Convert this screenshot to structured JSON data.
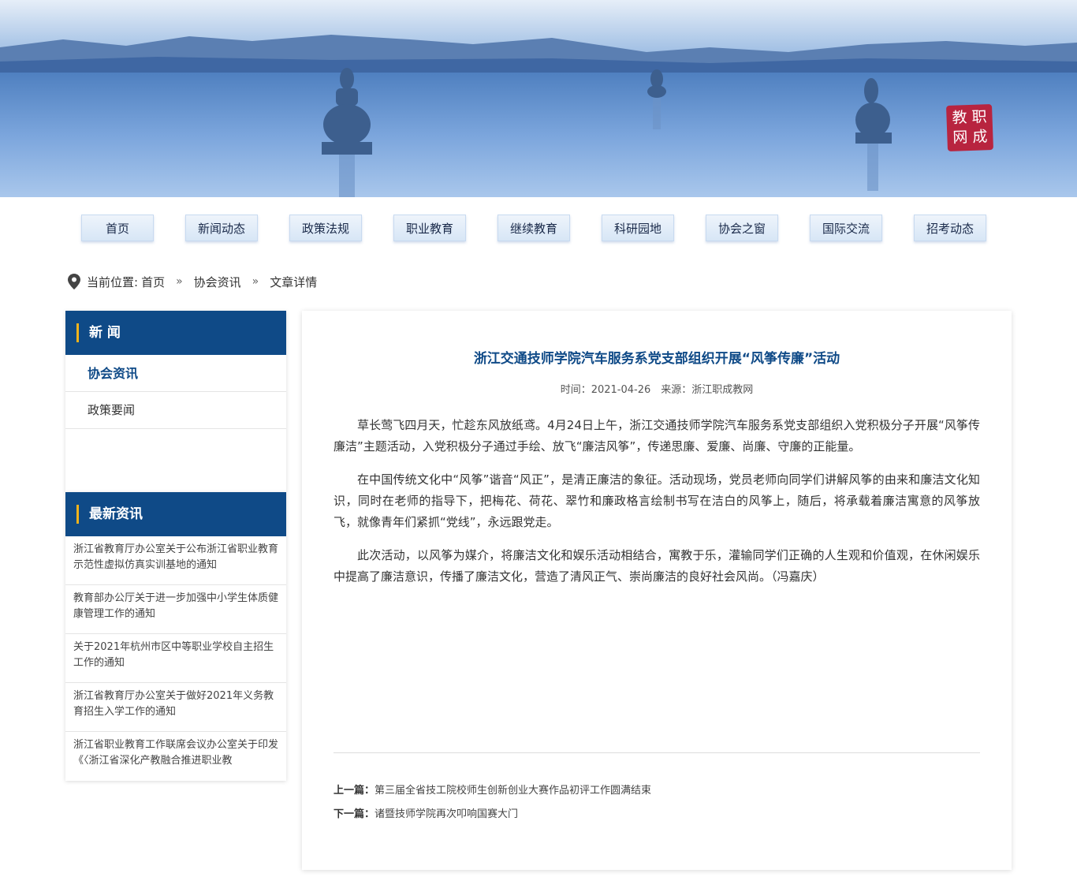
{
  "banner": {
    "seal_chars": [
      "教",
      "职",
      "网",
      "成"
    ]
  },
  "nav": {
    "items": [
      "首页",
      "新闻动态",
      "政策法规",
      "职业教育",
      "继续教育",
      "科研园地",
      "协会之窗",
      "国际交流",
      "招考动态"
    ]
  },
  "breadcrumb": {
    "prefix": "当前位置:",
    "home": "首页",
    "sep": "»",
    "section": "协会资讯",
    "current": "文章详情"
  },
  "sidebar": {
    "news_title": "新 闻",
    "news_items": [
      "协会资讯",
      "政策要闻"
    ],
    "latest_title": "最新资讯",
    "latest_items": [
      "浙江省教育厅办公室关于公布浙江省职业教育示范性虚拟仿真实训基地的通知",
      "教育部办公厅关于进一步加强中小学生体质健康管理工作的通知",
      "关于2021年杭州市区中等职业学校自主招生工作的通知",
      "浙江省教育厅办公室关于做好2021年义务教育招生入学工作的通知",
      "浙江省职业教育工作联席会议办公室关于印发《〈浙江省深化产教融合推进职业教"
    ]
  },
  "article": {
    "title": "浙江交通技师学院汽车服务系党支部组织开展“风筝传廉”活动",
    "meta": "时间：2021-04-26　来源：浙江职成教网",
    "paragraphs": [
      "草长莺飞四月天，忙趁东风放纸鸢。4月24日上午，浙江交通技师学院汽车服务系党支部组织入党积极分子开展“风筝传廉洁”主题活动，入党积极分子通过手绘、放飞“廉洁风筝”，传递思廉、爱廉、尚廉、守廉的正能量。",
      "在中国传统文化中“风筝”谐音“风正”，是清正廉洁的象征。活动现场，党员老师向同学们讲解风筝的由来和廉洁文化知识，同时在老师的指导下，把梅花、荷花、翠竹和廉政格言绘制书写在洁白的风筝上，随后，将承载着廉洁寓意的风筝放飞，就像青年们紧抓“党线”，永远跟党走。",
      "此次活动，以风筝为媒介，将廉洁文化和娱乐活动相结合，寓教于乐，灌输同学们正确的人生观和价值观，在休闲娱乐中提高了廉洁意识，传播了廉洁文化，营造了清风正气、崇尚廉洁的良好社会风尚。（冯嘉庆）"
    ],
    "prev_label": "上一篇：",
    "prev_title": "第三届全省技工院校师生创新创业大赛作品初评工作圆满结束",
    "next_label": "下一篇：",
    "next_title": "诸暨技师学院再次叩响国赛大门"
  },
  "colors": {
    "primary": "#0f4a87",
    "accent": "#f2b31b",
    "seal": "#b8243f"
  }
}
